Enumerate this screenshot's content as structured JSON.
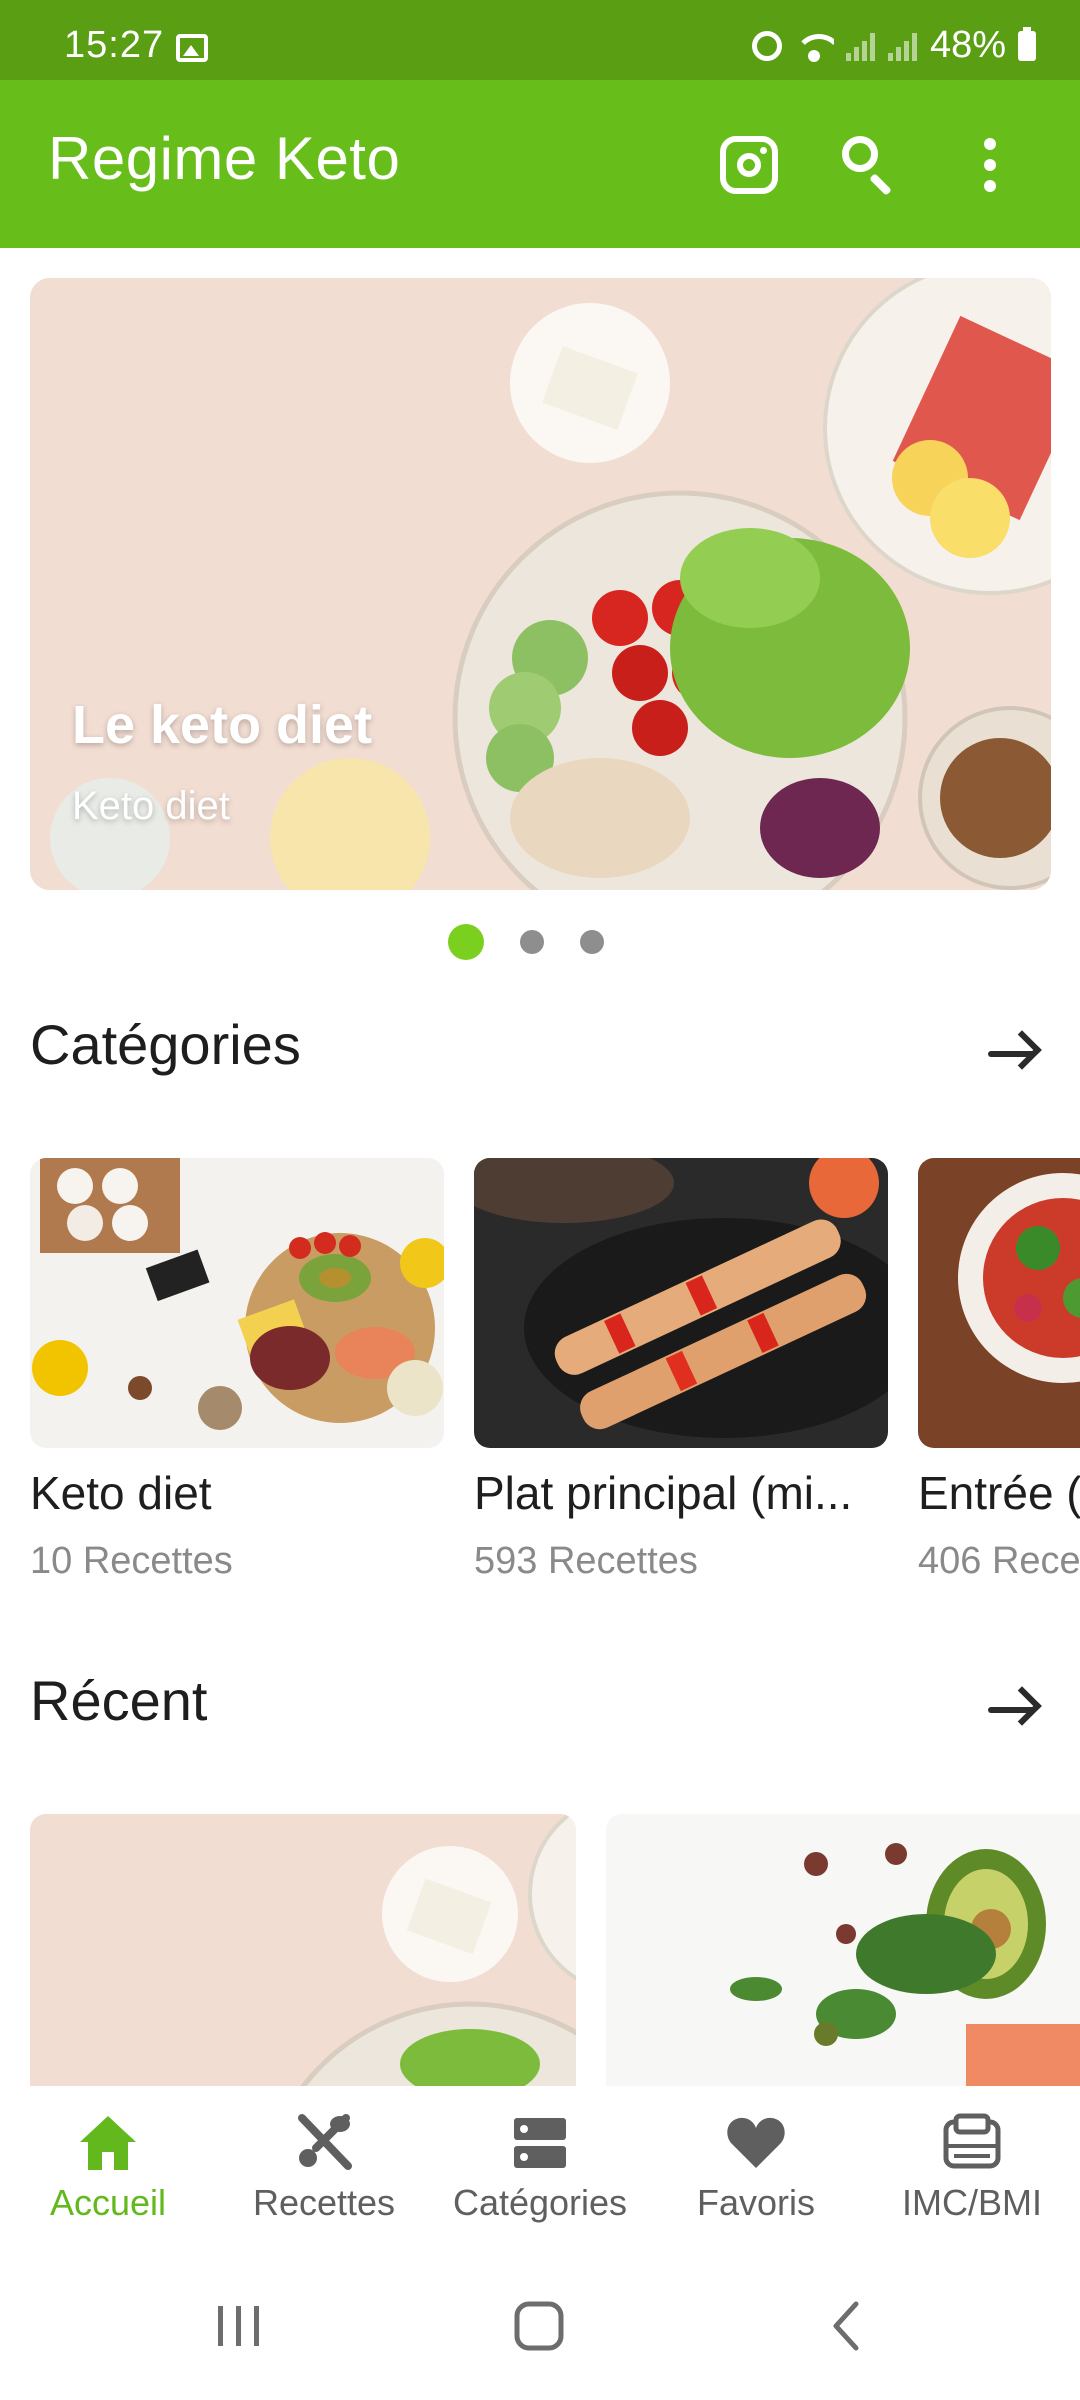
{
  "status_bar": {
    "time": "15:27",
    "battery": "48%"
  },
  "app_bar": {
    "title": "Regime Keto"
  },
  "banner": {
    "title": "Le keto diet",
    "subtitle": "Keto diet",
    "page_count": 3,
    "active_page": 1
  },
  "categories": {
    "title": "Catégories",
    "items": [
      {
        "name": "Keto diet",
        "count": "10 Recettes"
      },
      {
        "name": "Plat principal (mi...",
        "count": "593 Recettes"
      },
      {
        "name": "Entrée (",
        "count": "406 Rece"
      }
    ]
  },
  "recent": {
    "title": "Récent"
  },
  "bottom_nav": {
    "items": [
      {
        "label": "Accueil",
        "icon": "home-icon",
        "active": true
      },
      {
        "label": "Recettes",
        "icon": "utensils-icon",
        "active": false
      },
      {
        "label": "Catégories",
        "icon": "categories-icon",
        "active": false
      },
      {
        "label": "Favoris",
        "icon": "heart-icon",
        "active": false
      },
      {
        "label": "IMC/BMI",
        "icon": "scale-icon",
        "active": false
      }
    ]
  },
  "colors": {
    "accent": "#67bd1a",
    "status_bar": "#5a9e14",
    "active_nav": "#62b81c"
  }
}
